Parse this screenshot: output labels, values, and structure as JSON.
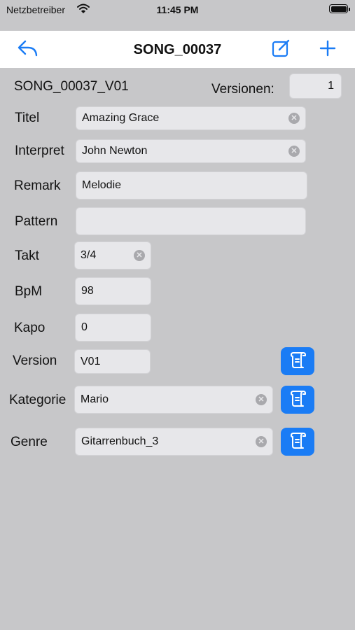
{
  "status_bar": {
    "carrier": "Netzbetreiber",
    "time": "11:45 PM",
    "wifi_icon": "wifi-icon",
    "battery_icon": "battery-icon"
  },
  "nav": {
    "title": "SONG_00037",
    "back_icon": "reply-arrow-icon",
    "edit_icon": "compose-icon",
    "add_icon": "plus-icon"
  },
  "header": {
    "song_id": "SONG_00037_V01",
    "versions_label": "Versionen:",
    "versions_value": "1"
  },
  "fields": {
    "titel": {
      "label": "Titel",
      "value": "Amazing Grace"
    },
    "interpret": {
      "label": "Interpret",
      "value": "John Newton"
    },
    "remark": {
      "label": "Remark",
      "value": "Melodie"
    },
    "pattern": {
      "label": "Pattern",
      "value": ""
    },
    "takt": {
      "label": "Takt",
      "value": "3/4"
    },
    "bpm": {
      "label": "BpM",
      "value": "98"
    },
    "kapo": {
      "label": "Kapo",
      "value": "0"
    },
    "version": {
      "label": "Version",
      "value": "V01"
    },
    "kategorie": {
      "label": "Kategorie",
      "value": "Mario"
    },
    "genre": {
      "label": "Genre",
      "value": "Gitarrenbuch_3"
    }
  },
  "colors": {
    "accent": "#1a7cf5",
    "background": "#c7c7c9",
    "navbar": "#ffffff"
  }
}
